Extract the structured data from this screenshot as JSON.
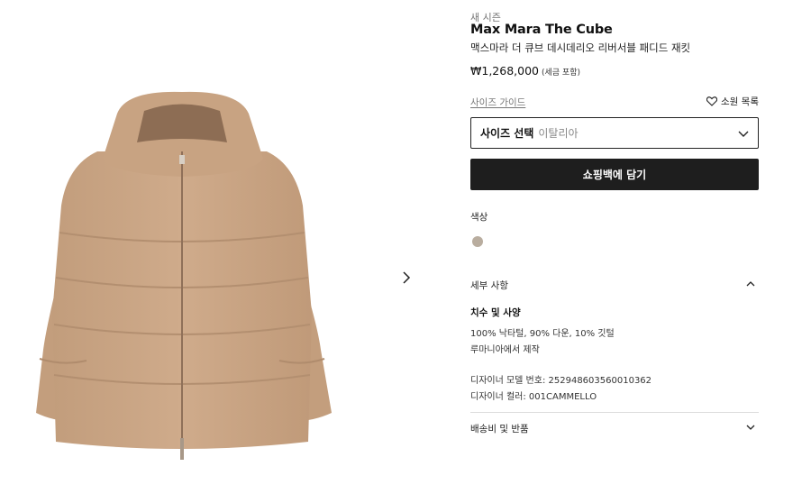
{
  "gallery": {
    "next_icon": "chevron-right-icon"
  },
  "product": {
    "season": "새 시즌",
    "brand": "Max Mara The Cube",
    "name": "맥스마라 더 큐브 데시데리오 리버서블 패디드 재킷",
    "price": "₩1,268,000",
    "tax_note": "(세금 포함)"
  },
  "actions": {
    "size_guide": "사이즈 가이드",
    "wishlist": "소원 목록",
    "wishlist_icon": "heart-icon",
    "size_select_label": "사이즈 선택",
    "size_select_value": "이탈리아",
    "add_to_bag": "쇼핑백에 담기"
  },
  "color": {
    "label": "색상",
    "swatch_color": "#b9ad9f"
  },
  "details": {
    "heading": "세부 사항",
    "spec_title": "치수 및 사양",
    "lines": [
      "100% 낙타털, 90% 다운, 10% 깃털",
      "루마니아에서 제작",
      "디자이너 모델 번호: 252948603560010362",
      "디자이너 컬러: 001CAMMELLO"
    ]
  },
  "shipping": {
    "heading": "배송비 및 반품"
  },
  "colors": {
    "button_bg": "#1e1e1e",
    "jacket": "#c9a484"
  }
}
